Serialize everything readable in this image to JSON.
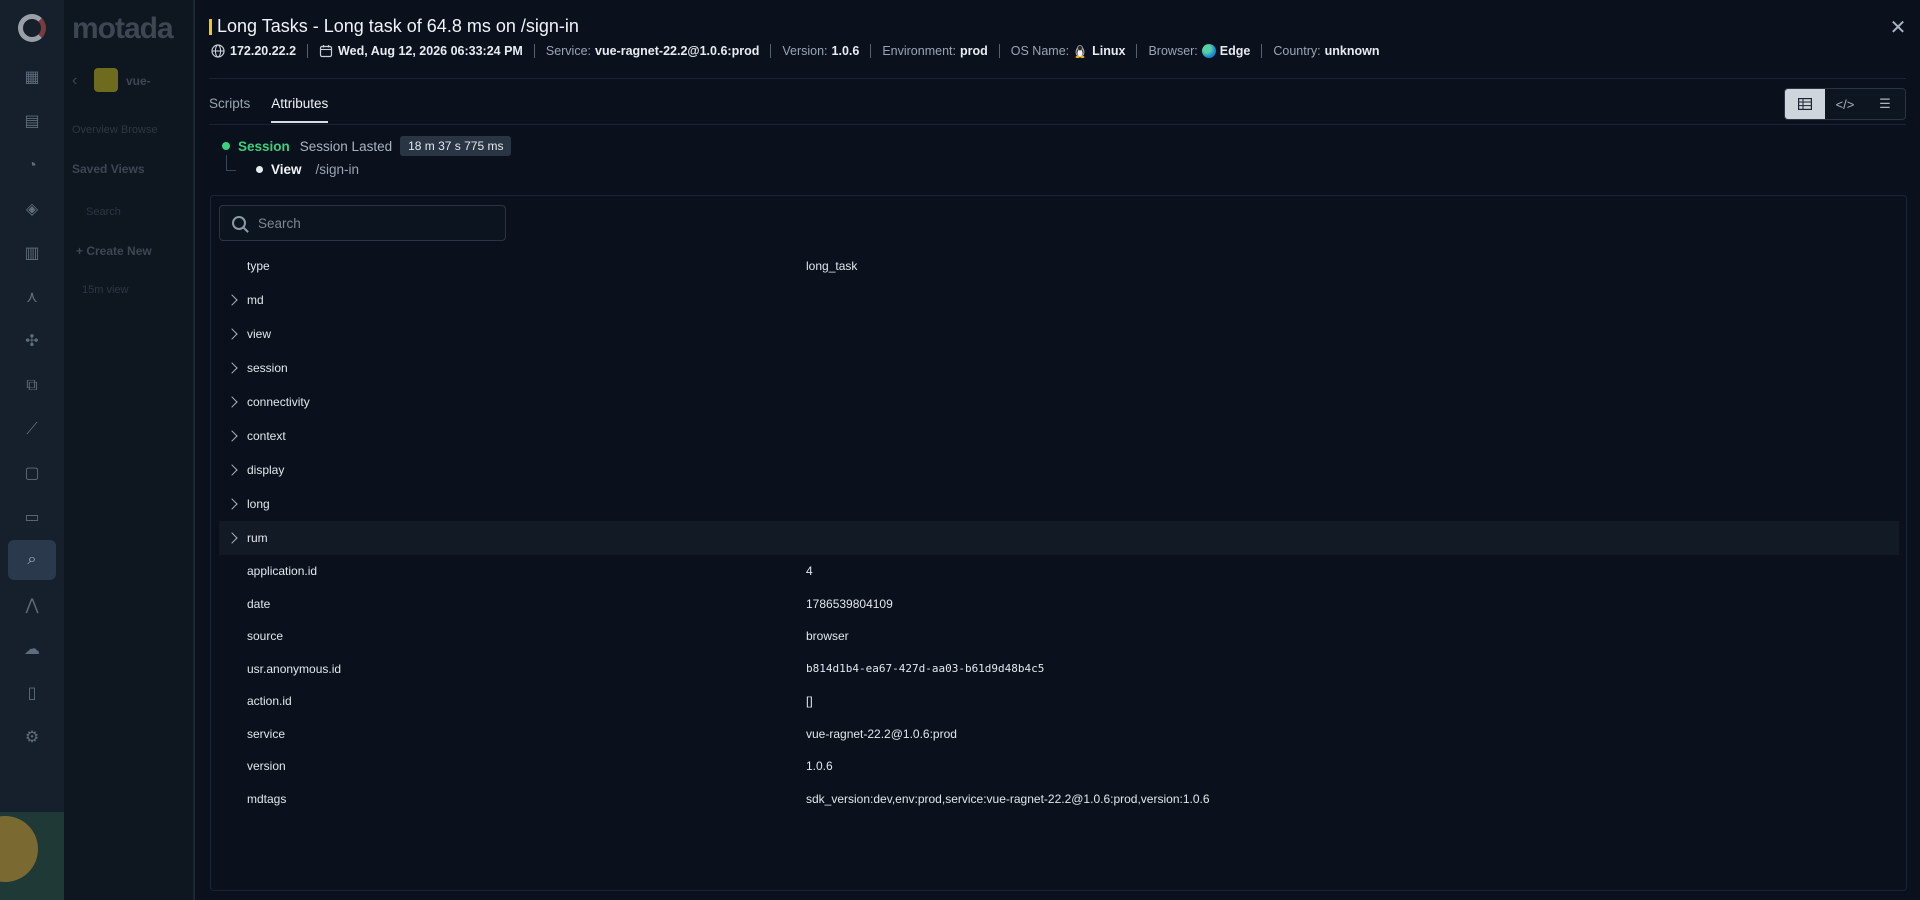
{
  "background": {
    "brand": "motada",
    "app_name": "vue-",
    "tabs_faded": "Overview  Browse",
    "saved_views": "Saved Views",
    "search": "Search",
    "create_new": "+ Create New",
    "list_item": "15m view"
  },
  "drawer": {
    "title": "Long Tasks - Long task of 64.8 ms on /sign-in",
    "meta": {
      "ip": "172.20.22.2",
      "datetime": "Wed, Aug 12, 2026 06:33:24 PM",
      "service_label": "Service:",
      "service": "vue-ragnet-22.2@1.0.6:prod",
      "version_label": "Version:",
      "version": "1.0.6",
      "environment_label": "Environment:",
      "environment": "prod",
      "os_label": "OS Name:",
      "os": "Linux",
      "browser_label": "Browser:",
      "browser": "Edge",
      "country_label": "Country:",
      "country": "unknown"
    },
    "tabs": [
      {
        "label": "Scripts"
      },
      {
        "label": "Attributes"
      }
    ],
    "session": {
      "label": "Session",
      "lasted_label": "Session Lasted",
      "duration": "18 m 37 s 775 ms"
    },
    "view": {
      "label": "View",
      "path": "/sign-in"
    },
    "search_placeholder": "Search",
    "attributes": [
      {
        "key": "type",
        "value": "long_task",
        "expandable": false
      },
      {
        "key": "md",
        "value": "",
        "expandable": true
      },
      {
        "key": "view",
        "value": "",
        "expandable": true
      },
      {
        "key": "session",
        "value": "",
        "expandable": true
      },
      {
        "key": "connectivity",
        "value": "",
        "expandable": true
      },
      {
        "key": "context",
        "value": "",
        "expandable": true
      },
      {
        "key": "display",
        "value": "",
        "expandable": true
      },
      {
        "key": "long",
        "value": "",
        "expandable": true
      },
      {
        "key": "rum",
        "value": "",
        "expandable": true
      },
      {
        "key": "application.id",
        "value": "4",
        "expandable": false
      },
      {
        "key": "date",
        "value": "1786539804109",
        "expandable": false
      },
      {
        "key": "source",
        "value": "browser",
        "expandable": false
      },
      {
        "key": "usr.anonymous.id",
        "value": "b814d1b4-ea67-427d-aa03-b61d9d48b4c5",
        "expandable": false
      },
      {
        "key": "action.id",
        "value": "[]",
        "expandable": false
      },
      {
        "key": "service",
        "value": "vue-ragnet-22.2@1.0.6:prod",
        "expandable": false
      },
      {
        "key": "version",
        "value": "1.0.6",
        "expandable": false
      },
      {
        "key": "mdtags",
        "value": "sdk_version:dev,env:prod,service:vue-ragnet-22.2@1.0.6:prod,version:1.0.6",
        "expandable": false
      }
    ],
    "colors": {
      "accent_yellow": "#f5c518",
      "session_green": "#3ad07c",
      "background": "#0a111c"
    }
  }
}
